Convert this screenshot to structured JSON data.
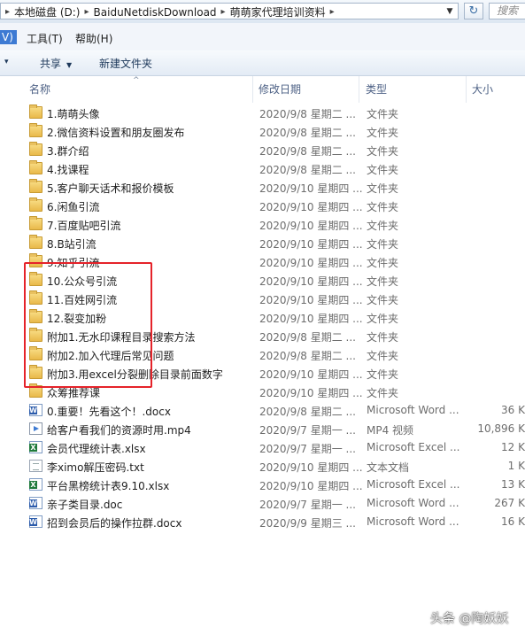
{
  "address": {
    "crumbs": [
      "本地磁盘 (D:)",
      "BaiduNetdiskDownload",
      "萌萌家代理培训资料"
    ],
    "search_placeholder": "搜索 "
  },
  "menu": {
    "items": [
      "V)",
      "工具(T)",
      "帮助(H)"
    ]
  },
  "toolbar": {
    "share_label": "共享",
    "new_folder_label": "新建文件夹"
  },
  "columns": {
    "name": "名称",
    "date": "修改日期",
    "type": "类型",
    "size": "大小"
  },
  "files": [
    {
      "name": "1.萌萌头像",
      "date": "2020/9/8 星期二 ...",
      "type": "文件夹",
      "size": "",
      "icon": "folder-icon"
    },
    {
      "name": "2.微信资料设置和朋友圈发布",
      "date": "2020/9/8 星期二 ...",
      "type": "文件夹",
      "size": "",
      "icon": "folder-icon"
    },
    {
      "name": "3.群介绍",
      "date": "2020/9/8 星期二 ...",
      "type": "文件夹",
      "size": "",
      "icon": "folder-icon"
    },
    {
      "name": "4.找课程",
      "date": "2020/9/8 星期二 ...",
      "type": "文件夹",
      "size": "",
      "icon": "folder-icon"
    },
    {
      "name": "5.客户聊天话术和报价模板",
      "date": "2020/9/10 星期四 ...",
      "type": "文件夹",
      "size": "",
      "icon": "folder-icon"
    },
    {
      "name": "6.闲鱼引流",
      "date": "2020/9/10 星期四 ...",
      "type": "文件夹",
      "size": "",
      "icon": "folder-icon"
    },
    {
      "name": "7.百度贴吧引流",
      "date": "2020/9/10 星期四 ...",
      "type": "文件夹",
      "size": "",
      "icon": "folder-icon"
    },
    {
      "name": "8.B站引流",
      "date": "2020/9/10 星期四 ...",
      "type": "文件夹",
      "size": "",
      "icon": "folder-icon"
    },
    {
      "name": "9.知乎引流",
      "date": "2020/9/10 星期四 ...",
      "type": "文件夹",
      "size": "",
      "icon": "folder-icon"
    },
    {
      "name": "10.公众号引流",
      "date": "2020/9/10 星期四 ...",
      "type": "文件夹",
      "size": "",
      "icon": "folder-icon"
    },
    {
      "name": "11.百姓网引流",
      "date": "2020/9/10 星期四 ...",
      "type": "文件夹",
      "size": "",
      "icon": "folder-icon"
    },
    {
      "name": "12.裂变加粉",
      "date": "2020/9/10 星期四 ...",
      "type": "文件夹",
      "size": "",
      "icon": "folder-icon"
    },
    {
      "name": "附加1.无水印课程目录搜索方法",
      "date": "2020/9/8 星期二 ...",
      "type": "文件夹",
      "size": "",
      "icon": "folder-icon"
    },
    {
      "name": "附加2.加入代理后常见问题",
      "date": "2020/9/8 星期二 ...",
      "type": "文件夹",
      "size": "",
      "icon": "folder-icon"
    },
    {
      "name": "附加3.用excel分裂删除目录前面数字",
      "date": "2020/9/10 星期四 ...",
      "type": "文件夹",
      "size": "",
      "icon": "folder-icon"
    },
    {
      "name": "众筹推荐课",
      "date": "2020/9/10 星期四 ...",
      "type": "文件夹",
      "size": "",
      "icon": "folder-icon"
    },
    {
      "name": "0.重要！先看这个！.docx",
      "date": "2020/9/8 星期二 ...",
      "type": "Microsoft Word ...",
      "size": "36 K",
      "icon": "word-doc-icon"
    },
    {
      "name": "给客户看我们的资源时用.mp4",
      "date": "2020/9/7 星期一 ...",
      "type": "MP4 视频",
      "size": "10,896 K",
      "icon": "video-file-icon"
    },
    {
      "name": "会员代理统计表.xlsx",
      "date": "2020/9/7 星期一 ...",
      "type": "Microsoft Excel ...",
      "size": "12 K",
      "icon": "excel-file-icon"
    },
    {
      "name": "李ximo解压密码.txt",
      "date": "2020/9/10 星期四 ...",
      "type": "文本文档",
      "size": "1 K",
      "icon": "text-file-icon"
    },
    {
      "name": "平台黑榜统计表9.10.xlsx",
      "date": "2020/9/10 星期四 ...",
      "type": "Microsoft Excel ...",
      "size": "13 K",
      "icon": "excel-file-icon"
    },
    {
      "name": "亲子类目录.doc",
      "date": "2020/9/7 星期一 ...",
      "type": "Microsoft Word ...",
      "size": "267 K",
      "icon": "word-doc-icon"
    },
    {
      "name": "招到会员后的操作拉群.docx",
      "date": "2020/9/9 星期三 ...",
      "type": "Microsoft Word ...",
      "size": "16 K",
      "icon": "word-doc-icon"
    }
  ],
  "watermark": "头条 @陶妖妖",
  "colors": {
    "highlight": "#e5232a",
    "menu_selected": "#3d7ad3"
  }
}
